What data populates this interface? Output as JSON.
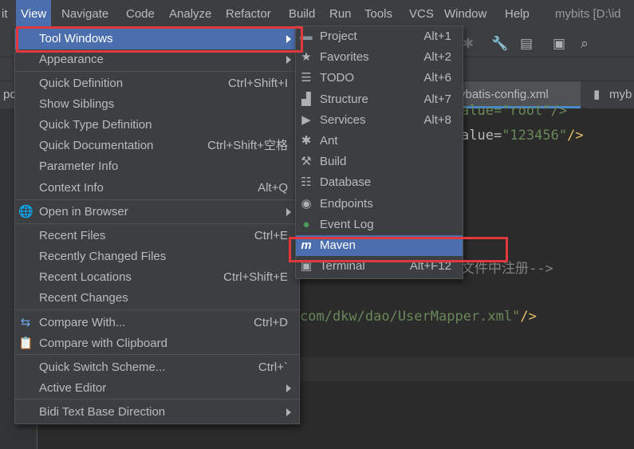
{
  "menubar": {
    "partial_left": "it",
    "items": [
      "View",
      "Navigate",
      "Code",
      "Analyze",
      "Refactor",
      "Build",
      "Run",
      "Tools",
      "VCS",
      "Window",
      "Help"
    ],
    "title": "mybits [D:\\id"
  },
  "tabs": {
    "left_partial": "po",
    "config_tab": "ybatis-config.xml",
    "right_partial": "myb"
  },
  "editor": {
    "line1_text": "alue=\"root\"/>",
    "line2_attr": "alue=",
    "line2_val": "\"123456\"",
    "line2_end": "/>",
    "comment": "文件中注册-->",
    "mapper_val": "com/dkw/dao/UserMapper.xml\"",
    "mapper_end": "/>"
  },
  "view_menu": {
    "items": [
      {
        "label": "Tool Windows",
        "shortcut": "",
        "submenu": true
      },
      {
        "label": "Appearance",
        "shortcut": "",
        "submenu": true
      },
      {
        "label": "Quick Definition",
        "shortcut": "Ctrl+Shift+I",
        "submenu": false
      },
      {
        "label": "Show Siblings",
        "shortcut": "",
        "submenu": false
      },
      {
        "label": "Quick Type Definition",
        "shortcut": "",
        "submenu": false
      },
      {
        "label": "Quick Documentation",
        "shortcut": "Ctrl+Shift+空格",
        "submenu": false
      },
      {
        "label": "Parameter Info",
        "shortcut": "",
        "submenu": false
      },
      {
        "label": "Context Info",
        "shortcut": "Alt+Q",
        "submenu": false
      },
      {
        "label": "Open in Browser",
        "shortcut": "",
        "submenu": true
      },
      {
        "label": "Recent Files",
        "shortcut": "Ctrl+E",
        "submenu": false
      },
      {
        "label": "Recently Changed Files",
        "shortcut": "",
        "submenu": false
      },
      {
        "label": "Recent Locations",
        "shortcut": "Ctrl+Shift+E",
        "submenu": false
      },
      {
        "label": "Recent Changes",
        "shortcut": "",
        "submenu": false
      },
      {
        "label": "Compare With...",
        "shortcut": "Ctrl+D",
        "submenu": false
      },
      {
        "label": "Compare with Clipboard",
        "shortcut": "",
        "submenu": false
      },
      {
        "label": "Quick Switch Scheme...",
        "shortcut": "Ctrl+`",
        "submenu": false
      },
      {
        "label": "Active Editor",
        "shortcut": "",
        "submenu": true
      },
      {
        "label": "Bidi Text Base Direction",
        "shortcut": "",
        "submenu": true
      }
    ]
  },
  "tool_windows_menu": {
    "items": [
      {
        "label": "Project",
        "shortcut": "Alt+1",
        "icon": "folder-icon"
      },
      {
        "label": "Favorites",
        "shortcut": "Alt+2",
        "icon": "star-icon"
      },
      {
        "label": "TODO",
        "shortcut": "Alt+6",
        "icon": "list-icon"
      },
      {
        "label": "Structure",
        "shortcut": "Alt+7",
        "icon": "structure-icon"
      },
      {
        "label": "Services",
        "shortcut": "Alt+8",
        "icon": "services-icon"
      },
      {
        "label": "Ant",
        "shortcut": "",
        "icon": "ant-icon"
      },
      {
        "label": "Build",
        "shortcut": "",
        "icon": "hammer-icon"
      },
      {
        "label": "Database",
        "shortcut": "",
        "icon": "database-icon"
      },
      {
        "label": "Endpoints",
        "shortcut": "",
        "icon": "endpoints-icon"
      },
      {
        "label": "Event Log",
        "shortcut": "",
        "icon": "event-log-icon"
      },
      {
        "label": "Maven",
        "shortcut": "",
        "icon": "maven-icon"
      },
      {
        "label": "Terminal",
        "shortcut": "Alt+F12",
        "icon": "terminal-icon"
      }
    ]
  },
  "colors": {
    "highlight": "#4b6eaf",
    "annotation_red": "#e0383c",
    "menu_bg": "#3c3f41",
    "editor_bg": "#2b2b2b"
  }
}
